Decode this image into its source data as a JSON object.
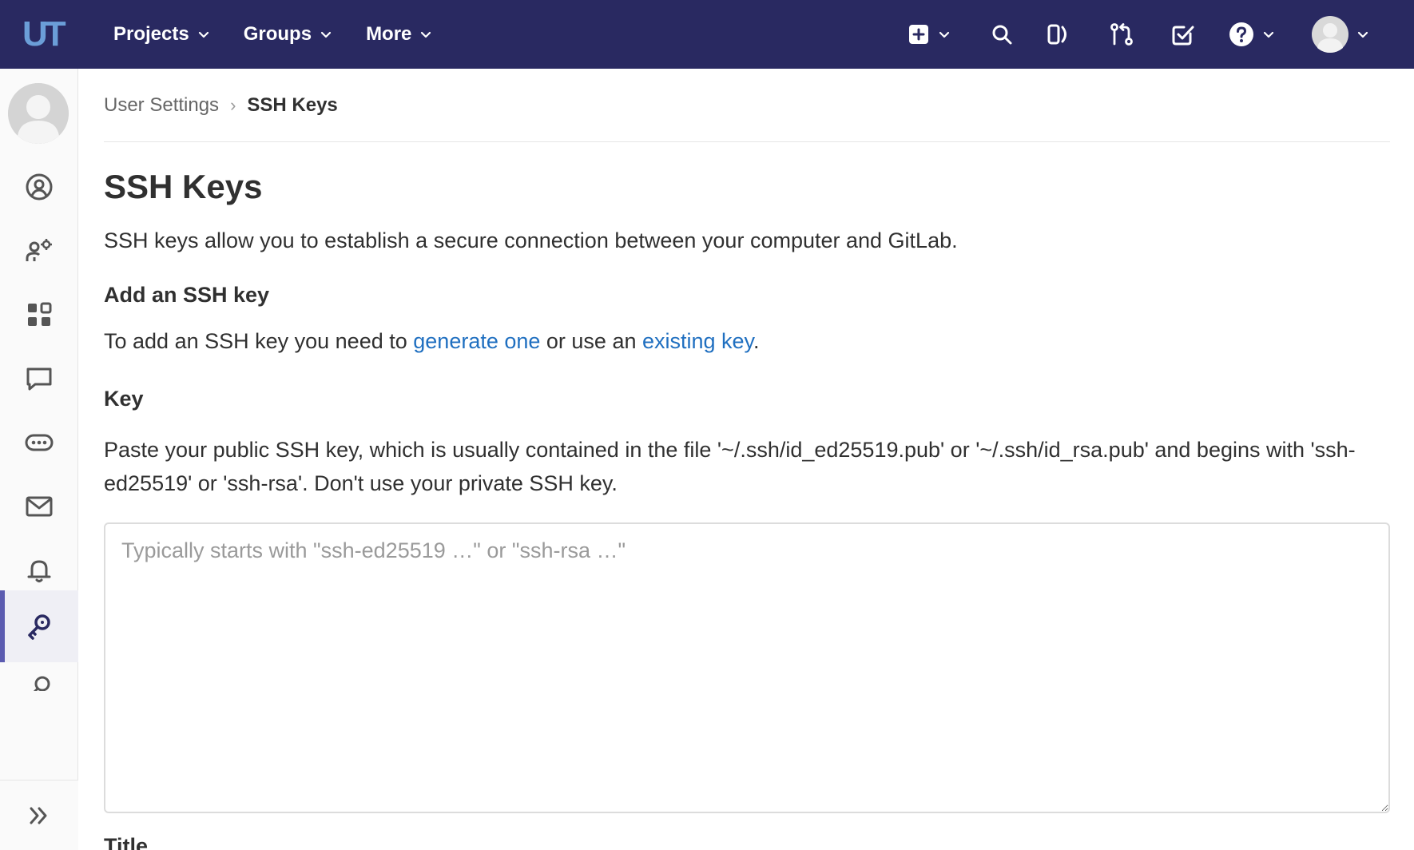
{
  "navbar": {
    "logo_text": "UT",
    "menu": [
      {
        "label": "Projects"
      },
      {
        "label": "Groups"
      },
      {
        "label": "More"
      }
    ],
    "colors": {
      "background": "#292961",
      "logo": "#6b9ed8"
    }
  },
  "breadcrumb": {
    "parent": "User Settings",
    "separator": "›",
    "current": "SSH Keys"
  },
  "page": {
    "title": "SSH Keys",
    "intro": "SSH keys allow you to establish a secure connection between your computer and GitLab.",
    "add_section_title": "Add an SSH key",
    "add_text_prefix": "To add an SSH key you need to ",
    "generate_link": "generate one",
    "add_text_middle": " or use an ",
    "existing_link": "existing key",
    "add_text_suffix": ".",
    "key_label": "Key",
    "key_help": "Paste your public SSH key, which is usually contained in the file '~/.ssh/id_ed25519.pub' or '~/.ssh/id_rsa.pub' and begins with 'ssh-ed25519' or 'ssh-rsa'. Don't use your private SSH key.",
    "key_placeholder": "Typically starts with \"ssh-ed25519 …\" or \"ssh-rsa …\"",
    "key_value": "",
    "title_label": "Title"
  },
  "sidebar": {
    "items": [
      {
        "icon": "profile-icon"
      },
      {
        "icon": "account-icon"
      },
      {
        "icon": "applications-icon"
      },
      {
        "icon": "chat-icon"
      },
      {
        "icon": "access-tokens-icon"
      },
      {
        "icon": "emails-icon"
      },
      {
        "icon": "notifications-icon"
      },
      {
        "icon": "ssh-key-icon",
        "active": true
      },
      {
        "icon": "gpg-key-icon"
      }
    ],
    "collapse_icon": "collapse-icon"
  },
  "colors": {
    "link": "#1f6fc0",
    "active_indicator": "#5b5bb0"
  }
}
